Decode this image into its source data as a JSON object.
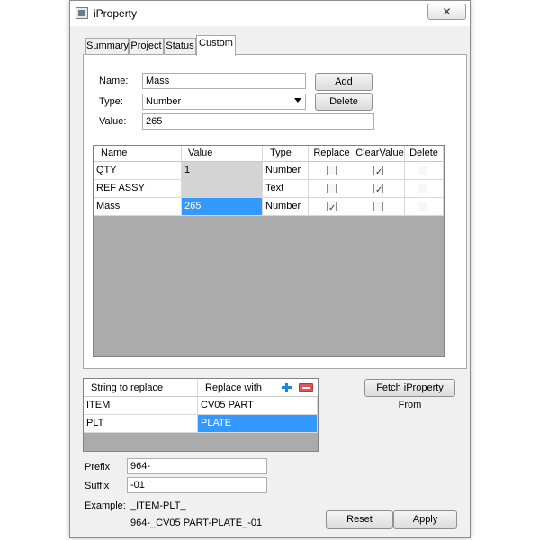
{
  "window": {
    "title": "iProperty",
    "close_glyph": "✕"
  },
  "tabs": [
    {
      "label": "Summary"
    },
    {
      "label": "Project"
    },
    {
      "label": "Status"
    },
    {
      "label": "Custom",
      "active": true
    }
  ],
  "form": {
    "name_label": "Name:",
    "name_value": "Mass",
    "type_label": "Type:",
    "type_value": "Number",
    "value_label": "Value:",
    "value_value": "265",
    "add_label": "Add",
    "delete_label": "Delete"
  },
  "grid": {
    "columns": [
      "Name",
      "Value",
      "Type",
      "Replace",
      "ClearValue",
      "Delete"
    ],
    "rows": [
      {
        "name": "QTY",
        "value": "1",
        "type": "Number",
        "replace": false,
        "clear_value": true,
        "delete": false
      },
      {
        "name": "REF ASSY",
        "value": "",
        "type": "Text",
        "replace": false,
        "clear_value": true,
        "delete": false
      },
      {
        "name": "Mass",
        "value": "265",
        "type": "Number",
        "replace": true,
        "clear_value": false,
        "delete": false
      }
    ]
  },
  "replace_grid": {
    "columns": [
      "String to replace",
      "Replace with"
    ],
    "rows": [
      {
        "from": "ITEM",
        "to": "CV05 PART"
      },
      {
        "from": "PLT",
        "to": "PLATE"
      }
    ]
  },
  "fetch_label": "Fetch iProperty From",
  "prefix": {
    "label": "Prefix",
    "value": "964-"
  },
  "suffix": {
    "label": "Suffix",
    "value": "-01"
  },
  "example": {
    "label": "Example:",
    "line1": "_ITEM-PLT_",
    "line2": "964-_CV05 PART-PLATE_-01"
  },
  "buttons": {
    "reset": "Reset",
    "apply": "Apply"
  },
  "colors": {
    "selection": "#3399ff",
    "grid_background": "#ababab"
  },
  "icons": {
    "add_row": "plus-icon",
    "remove_row": "minus-icon",
    "dropdown": "chevron-down-icon"
  }
}
